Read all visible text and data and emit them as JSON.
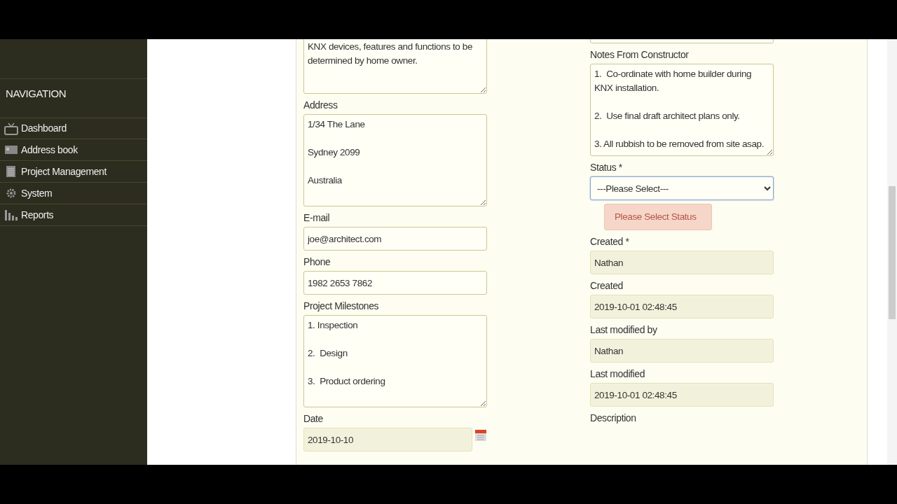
{
  "sidebar": {
    "heading": "NAVIGATION",
    "items": [
      {
        "label": "Dashboard"
      },
      {
        "label": "Address book"
      },
      {
        "label": "Project Management"
      },
      {
        "label": "System"
      },
      {
        "label": "Reports"
      }
    ]
  },
  "left_fields": [
    {
      "kind": "textarea",
      "value": "KNX devices, features and functions to be determined by home owner."
    },
    {
      "kind": "textarea",
      "label": "Address",
      "value": "1/34 The Lane\n\nSydney 2099\n\nAustralia"
    },
    {
      "kind": "input",
      "label": "E-mail",
      "value": "joe@architect.com"
    },
    {
      "kind": "input",
      "label": "Phone",
      "value": "1982 2653 7862"
    },
    {
      "kind": "textarea",
      "label": "Project Milestones",
      "value": "1. Inspection\n\n2.  Design\n\n3.  Product ordering"
    },
    {
      "kind": "date",
      "label": "Date",
      "value": "2019-10-10",
      "readonly": true
    }
  ],
  "right_fields": [
    {
      "kind": "stub"
    },
    {
      "kind": "textarea",
      "label": "Notes From Constructor",
      "value": "1.  Co-ordinate with home builder during KNX installation.\n\n2.  Use final draft architect plans only.\n\n3. All rubbish to be removed from site asap."
    },
    {
      "kind": "select",
      "label": "Status *",
      "value": "---Please Select---",
      "focused": true,
      "error": "Please Select Status"
    },
    {
      "kind": "input",
      "label": "Created *",
      "value": "Nathan",
      "readonly": true
    },
    {
      "kind": "input",
      "label": "Created",
      "value": "2019-10-01 02:48:45",
      "readonly": true
    },
    {
      "kind": "input",
      "label": "Last modified by",
      "value": "Nathan",
      "readonly": true
    },
    {
      "kind": "input",
      "label": "Last modified",
      "value": "2019-10-01 02:48:45",
      "readonly": true
    },
    {
      "kind": "label",
      "label": "Description"
    }
  ]
}
